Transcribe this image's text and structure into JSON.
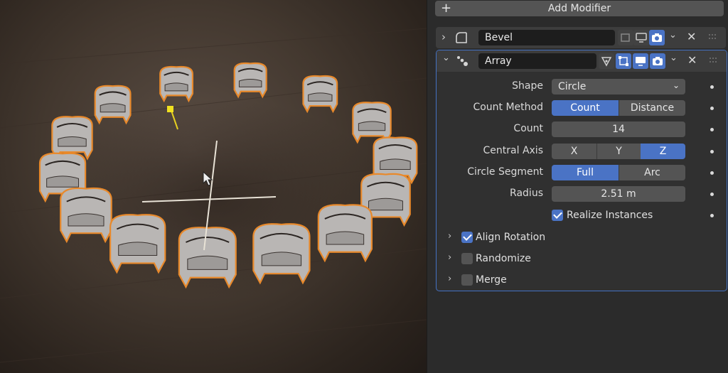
{
  "add_modifier": {
    "icon": "plus-icon",
    "label": "Add Modifier"
  },
  "modifiers": {
    "bevel": {
      "name": "Bevel",
      "expanded": false,
      "icon": "bevel-modifier-icon"
    },
    "array": {
      "name": "Array",
      "expanded": true,
      "icon": "array-modifier-icon",
      "properties": {
        "shape": {
          "label": "Shape",
          "value": "Circle"
        },
        "count_method": {
          "label": "Count Method",
          "options": [
            "Count",
            "Distance"
          ],
          "selected": "Count"
        },
        "count": {
          "label": "Count",
          "value": "14"
        },
        "central_axis": {
          "label": "Central Axis",
          "options": [
            "X",
            "Y",
            "Z"
          ],
          "selected": "Z"
        },
        "circle_segment": {
          "label": "Circle Segment",
          "options": [
            "Full",
            "Arc"
          ],
          "selected": "Full"
        },
        "radius": {
          "label": "Radius",
          "value": "2.51 m"
        },
        "realize_instances": {
          "label": "Realize Instances",
          "checked": true
        }
      },
      "subpanels": [
        {
          "label": "Align Rotation",
          "checked": true
        },
        {
          "label": "Randomize",
          "checked": false
        },
        {
          "label": "Merge",
          "checked": false
        }
      ]
    }
  },
  "colors": {
    "accent": "#4a73c5",
    "selection_outline": "#e8892b",
    "panel_bg": "#2b2b2b"
  }
}
